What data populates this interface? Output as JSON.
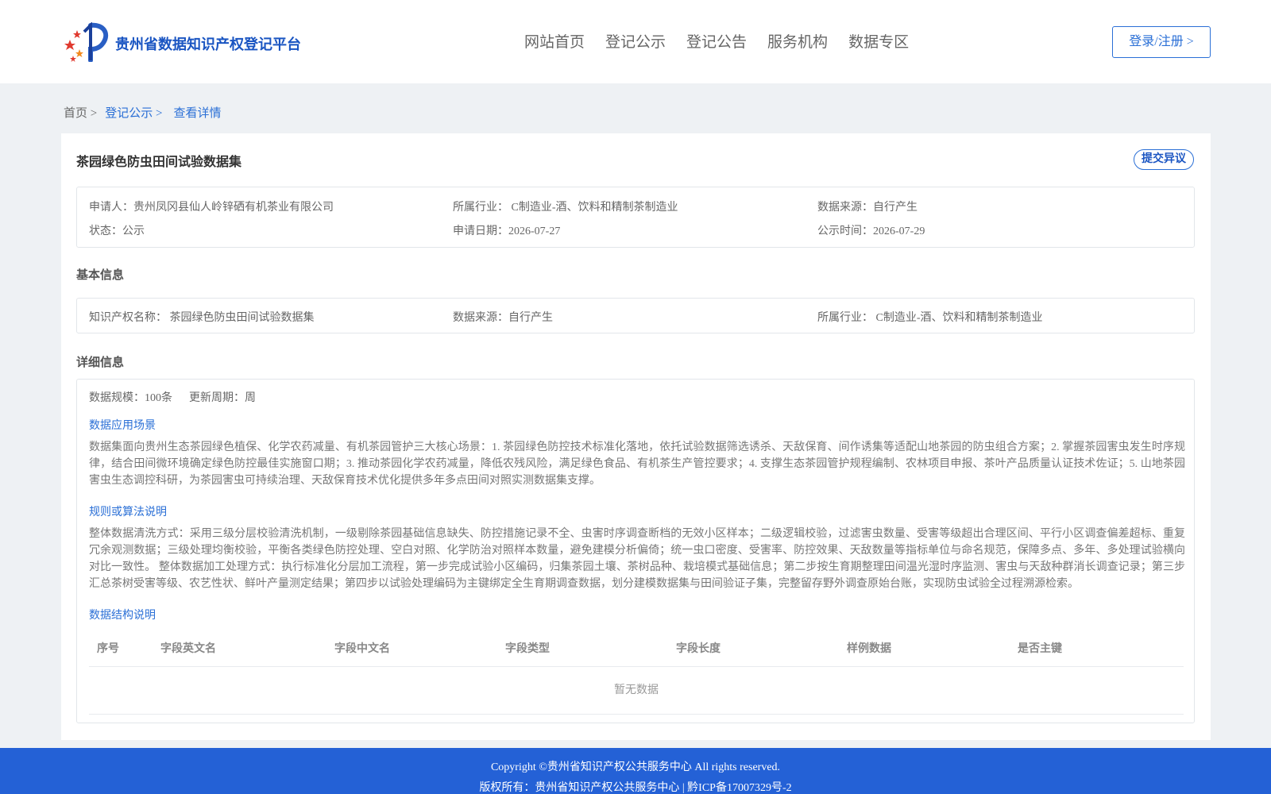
{
  "header": {
    "site_title": "贵州省数据知识产权登记平台",
    "nav": [
      "网站首页",
      "登记公示",
      "登记公告",
      "服务机构",
      "数据专区"
    ],
    "login_label": "登录/注册 >"
  },
  "breadcrumb": {
    "home": "首页 >",
    "section": "登记公示 >",
    "current": "查看详情"
  },
  "dataset": {
    "title": "茶园绿色防虫田间试验数据集",
    "objection_label": "提交异议",
    "applicant": "申请人：贵州凤冈县仙人岭锌硒有机茶业有限公司",
    "industry": "所属行业： C制造业-酒、饮料和精制茶制造业",
    "source": "数据来源：自行产生",
    "status": "状态：公示",
    "apply_date": "申请日期：2026-07-27",
    "publish_date": "公示时间：2026-07-29"
  },
  "basic": {
    "title": "基本信息",
    "ip_name": "知识产权名称： 茶园绿色防虫田间试验数据集",
    "source": "数据来源：自行产生",
    "industry": "所属行业： C制造业-酒、饮料和精制茶制造业"
  },
  "detail": {
    "title": "详细信息",
    "scale": "数据规模：100条",
    "cycle": "更新周期：周",
    "scenario_title": "数据应用场景",
    "scenario_text": "数据集面向贵州生态茶园绿色植保、化学农药减量、有机茶园管护三大核心场景：1. 茶园绿色防控技术标准化落地，依托试验数据筛选诱杀、天敌保育、间作诱集等适配山地茶园的防虫组合方案；2. 掌握茶园害虫发生时序规律，结合田间微环境确定绿色防控最佳实施窗口期；3. 推动茶园化学农药减量，降低农残风险，满足绿色食品、有机茶生产管控要求；4. 支撑生态茶园管护规程编制、农林项目申报、茶叶产品质量认证技术佐证；5. 山地茶园害虫生态调控科研，为茶园害虫可持续治理、天敌保育技术优化提供多年多点田间对照实测数据集支撑。",
    "rules_title": "规则或算法说明",
    "rules_text": "整体数据清洗方式：采用三级分层校验清洗机制，一级剔除茶园基础信息缺失、防控措施记录不全、虫害时序调查断档的无效小区样本；二级逻辑校验，过滤害虫数量、受害等级超出合理区间、平行小区调查偏差超标、重复冗余观测数据；三级处理均衡校验，平衡各类绿色防控处理、空白对照、化学防治对照样本数量，避免建模分析偏倚；统一虫口密度、受害率、防控效果、天敌数量等指标单位与命名规范，保障多点、多年、多处理试验横向对比一致性。 整体数据加工处理方式：执行标准化分层加工流程，第一步完成试验小区编码，归集茶园土壤、茶树品种、栽培模式基础信息；第二步按生育期整理田间温光湿时序监测、害虫与天敌种群消长调查记录；第三步汇总茶树受害等级、农艺性状、鲜叶产量测定结果；第四步以试验处理编码为主键绑定全生育期调查数据，划分建模数据集与田间验证子集，完整留存野外调查原始台账，实现防虫试验全过程溯源检索。",
    "structure_title": "数据结构说明",
    "columns": [
      "序号",
      "字段英文名",
      "字段中文名",
      "字段类型",
      "字段长度",
      "样例数据",
      "是否主键"
    ],
    "empty_text": "暂无数据"
  },
  "footer": {
    "copyright": "Copyright ©贵州省知识产权公共服务中心 All rights reserved.",
    "owner": "版权所有：贵州省知识产权公共服务中心 | 黔ICP备17007329号-2"
  }
}
